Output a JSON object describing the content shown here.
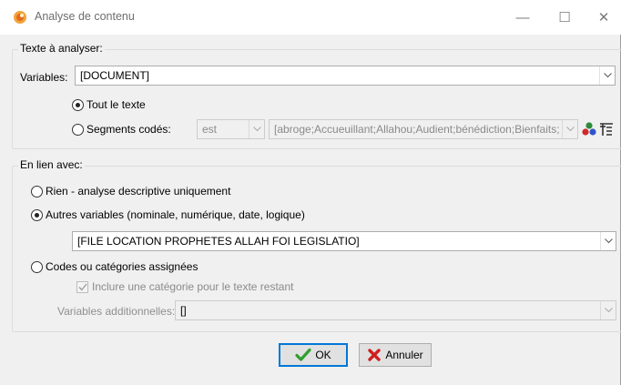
{
  "window": {
    "title": "Analyse de contenu",
    "minimize_glyph": "—",
    "maximize_glyph": "☐",
    "close_glyph": "✕"
  },
  "texte": {
    "group_label": "Texte à analyser:",
    "variables_label": "Variables:",
    "variables_value": "[DOCUMENT]",
    "radio_all": "Tout le texte",
    "radio_segments": "Segments codés:",
    "selected": "all",
    "op_value": "est",
    "codes_value": "[abroge;Accueuillant;Allahou;Audient;bénédiction;Bienfaits;C"
  },
  "lien": {
    "group_label": "En lien avec:",
    "radio_none": "Rien - analyse descriptive uniquement",
    "radio_vars": "Autres variables (nominale, numérique, date, logique)",
    "vars_value": "[FILE LOCATION PROPHETES ALLAH FOI LEGISLATIO]",
    "radio_codes": "Codes ou catégories assignées",
    "selected": "vars",
    "include_check": "Inclure une catégorie pour le texte restant",
    "include_checked": true,
    "add_vars_label": "Variables additionnelles:",
    "add_vars_value": "[]"
  },
  "buttons": {
    "ok": "OK",
    "cancel": "Annuler"
  },
  "icons": {
    "app": "provalis-logo-icon",
    "chevron": "chevron-down-icon",
    "code_colors": "colored-dots-icon",
    "code_filter": "code-filter-icon",
    "ok": "green-check-icon",
    "cancel": "red-x-icon"
  }
}
